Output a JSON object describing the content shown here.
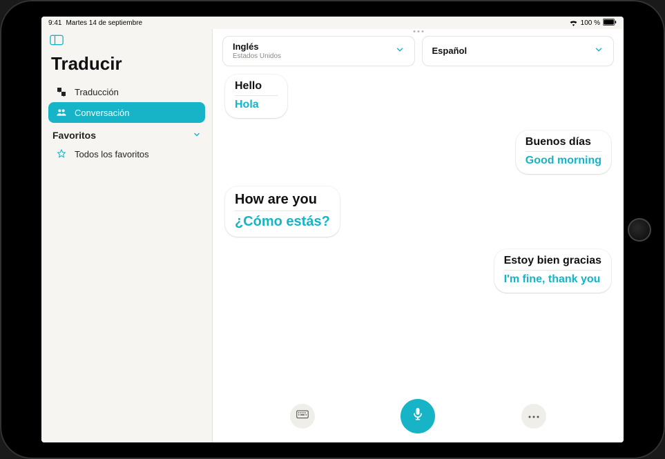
{
  "status": {
    "time": "9:41",
    "date": "Martes 14 de septiembre",
    "battery_text": "100 %"
  },
  "sidebar": {
    "title": "Traducir",
    "items": [
      {
        "label": "Traducción",
        "icon": "translate-icon",
        "active": false
      },
      {
        "label": "Conversación",
        "icon": "people-icon",
        "active": true
      }
    ],
    "favorites_header": "Favoritos",
    "favorites": [
      {
        "label": "Todos los favoritos",
        "icon": "star-icon"
      }
    ]
  },
  "languages": {
    "source": {
      "name": "Inglés",
      "sub": "Estados Unidos"
    },
    "target": {
      "name": "Español",
      "sub": ""
    }
  },
  "conversation": [
    {
      "side": "left",
      "original": "Hello",
      "translation": "Hola"
    },
    {
      "side": "right",
      "original": "Buenos días",
      "translation": "Good morning"
    },
    {
      "side": "left",
      "original": "How are you",
      "translation": "¿Cómo estás?",
      "large": true
    },
    {
      "side": "right",
      "original": "Estoy bien gracias",
      "translation": "I'm fine, thank you"
    }
  ],
  "controls": {
    "keyboard": "keyboard-icon",
    "mic": "microphone-icon",
    "more": "ellipsis-icon"
  },
  "colors": {
    "accent": "#16b4c6",
    "sidebar_bg": "#f6f5f2"
  }
}
